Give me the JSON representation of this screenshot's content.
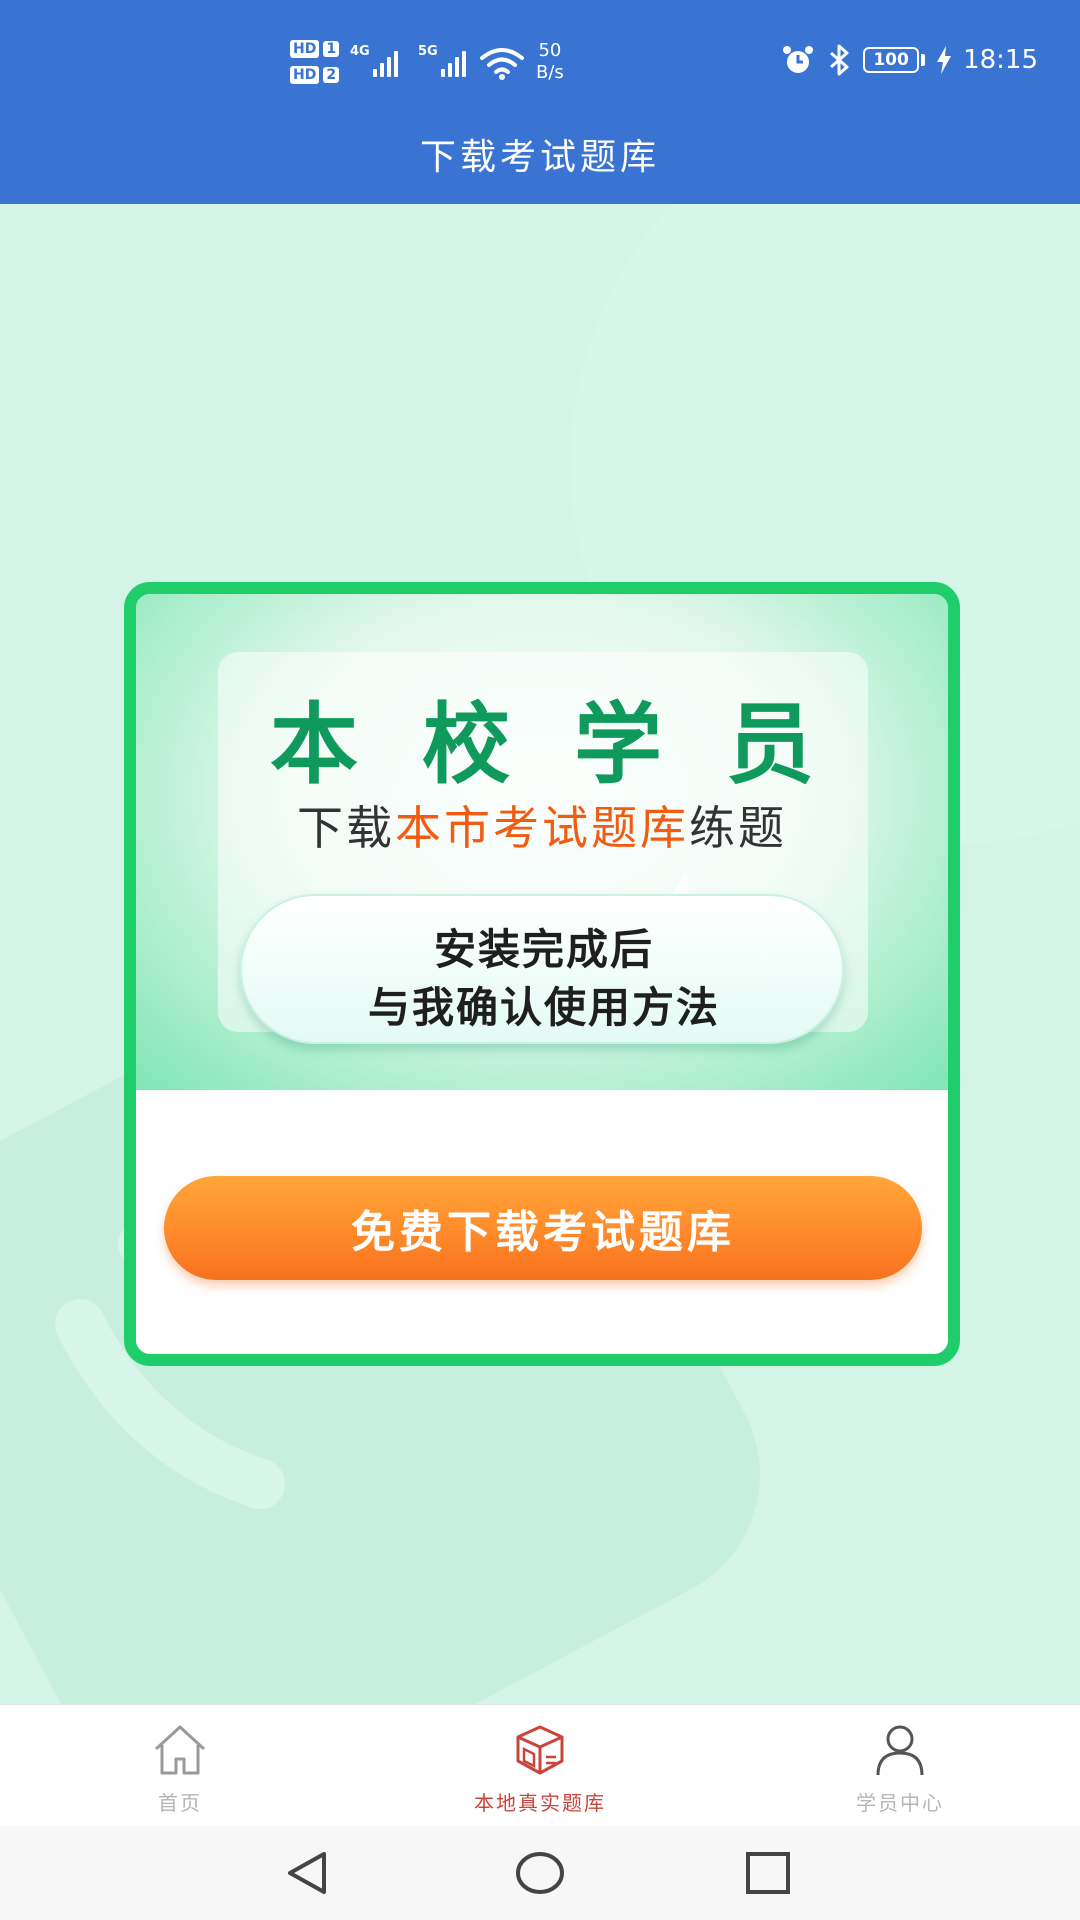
{
  "status_bar": {
    "sim1": "HD",
    "sim1_num": "1",
    "sim2": "HD",
    "sim2_num": "2",
    "net1": "4G",
    "net2": "5G",
    "speed_value": "50",
    "speed_unit": "B/s",
    "battery": "100",
    "time": "18:15",
    "icons": [
      "alarm-icon",
      "bluetooth-icon",
      "battery-icon",
      "charging-icon",
      "wifi-icon",
      "signal-icon"
    ]
  },
  "header": {
    "title": "下载考试题库"
  },
  "card": {
    "headline": "本校学员",
    "sub_prefix": "下载",
    "sub_highlight": "本市考试题库",
    "sub_suffix": "练题",
    "bubble_line1": "安装完成后",
    "bubble_line2": "与我确认使用方法",
    "cta_label": "免费下载考试题库"
  },
  "bottom_nav": {
    "items": [
      {
        "label": "首页",
        "icon": "home-icon",
        "active": false
      },
      {
        "label": "本地真实题库",
        "icon": "box-icon",
        "active": true
      },
      {
        "label": "学员中心",
        "icon": "user-icon",
        "active": false
      }
    ]
  },
  "colors": {
    "header_bg": "#3a74d3",
    "page_bg": "#d3f4e6",
    "card_border": "#1fce6b",
    "headline": "#0f9a5c",
    "highlight": "#f25b12",
    "cta": "#ff8a2a",
    "nav_active": "#c9443b",
    "nav_inactive": "#b5b5b5"
  }
}
